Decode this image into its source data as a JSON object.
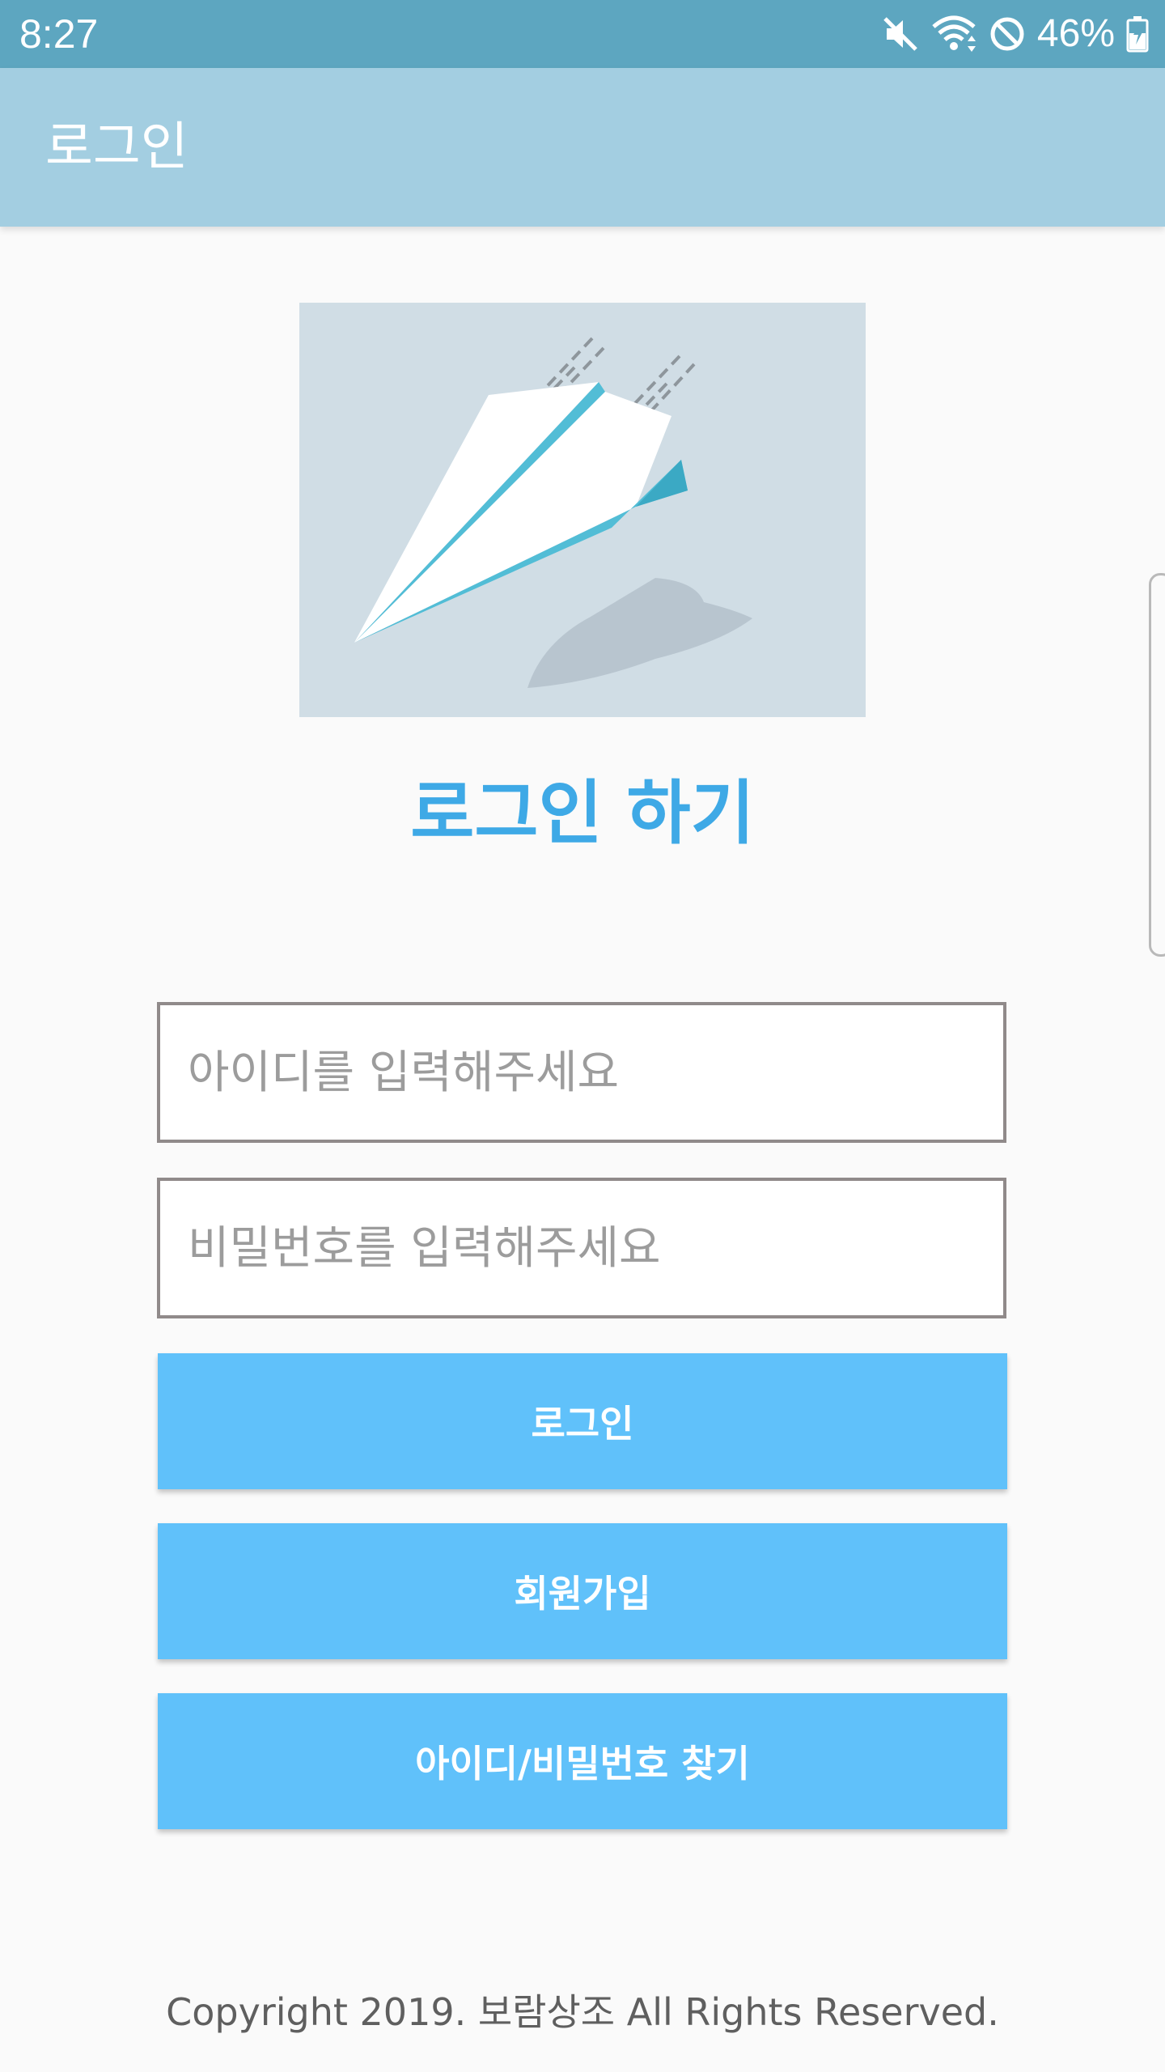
{
  "status_bar": {
    "time": "8:27",
    "battery": "46%",
    "icons": [
      "mute-icon",
      "wifi-icon",
      "no-disturb-icon",
      "battery-charging-icon"
    ]
  },
  "app_bar": {
    "title": "로그인"
  },
  "illustration": {
    "icon": "paper-plane-illustration"
  },
  "login": {
    "heading": "로그인 하기",
    "id_placeholder": "아이디를 입력해주세요",
    "password_placeholder": "비밀번호를 입력해주세요",
    "login_button": "로그인",
    "signup_button": "회원가입",
    "find_button": "아이디/비밀번호 찾기"
  },
  "footer": {
    "copyright": "Copyright 2019. 보람상조 All Rights Reserved."
  },
  "colors": {
    "status_bar": "#5da6c0",
    "app_bar": "#a3cee1",
    "heading": "#3ea9e6",
    "button": "#60c1fa",
    "illustration_bg": "#d0dde5",
    "plane_accent": "#52bdd6"
  }
}
